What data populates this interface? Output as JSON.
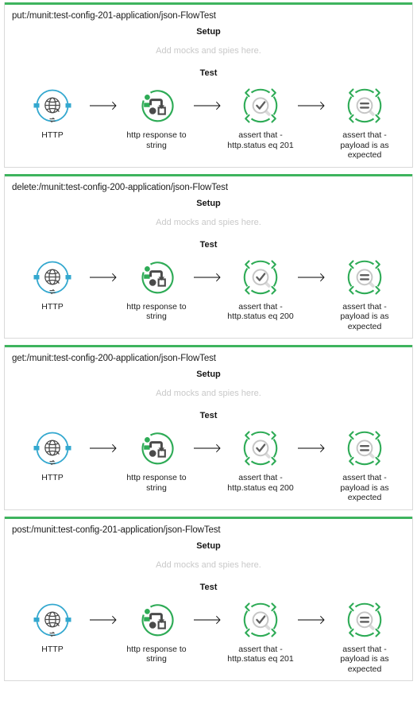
{
  "app": {
    "view_name": "MUnit Test Suite Flows",
    "accent_green": "#3eb45e",
    "http_blue": "#34a8cf",
    "placeholder_gray": "#c9c9c9"
  },
  "labels": {
    "setup": "Setup",
    "test": "Test",
    "mocks_placeholder": "Add mocks and spies here."
  },
  "icons": {
    "http": "http-listener-icon",
    "transform": "transform-message-icon",
    "assert_that": "assert-that-icon",
    "assert_equals": "assert-equals-icon",
    "arrow": "flow-arrow-icon"
  },
  "flows": [
    {
      "title": "put:/munit:test-config-201-application/json-FlowTest",
      "nodes": [
        {
          "label": "HTTP",
          "icon": "http"
        },
        {
          "label": "http response to string",
          "icon": "transform"
        },
        {
          "label": "assert that - http.status eq 201",
          "icon": "assert_that"
        },
        {
          "label": "assert that - payload is as expected",
          "icon": "assert_equals"
        }
      ]
    },
    {
      "title": "delete:/munit:test-config-200-application/json-FlowTest",
      "nodes": [
        {
          "label": "HTTP",
          "icon": "http"
        },
        {
          "label": "http response to string",
          "icon": "transform"
        },
        {
          "label": "assert that - http.status eq 200",
          "icon": "assert_that"
        },
        {
          "label": "assert that - payload is as expected",
          "icon": "assert_equals"
        }
      ]
    },
    {
      "title": "get:/munit:test-config-200-application/json-FlowTest",
      "nodes": [
        {
          "label": "HTTP",
          "icon": "http"
        },
        {
          "label": "http response to string",
          "icon": "transform"
        },
        {
          "label": "assert that - http.status eq 200",
          "icon": "assert_that"
        },
        {
          "label": "assert that - payload is as expected",
          "icon": "assert_equals"
        }
      ]
    },
    {
      "title": "post:/munit:test-config-201-application/json-FlowTest",
      "nodes": [
        {
          "label": "HTTP",
          "icon": "http"
        },
        {
          "label": "http response to string",
          "icon": "transform"
        },
        {
          "label": "assert that - http.status eq 201",
          "icon": "assert_that"
        },
        {
          "label": "assert that - payload is as expected",
          "icon": "assert_equals"
        }
      ]
    }
  ]
}
